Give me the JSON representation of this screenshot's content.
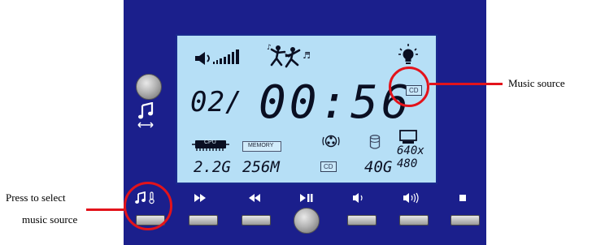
{
  "lcd": {
    "track": "02/",
    "time": "00:56",
    "cpu_label": "CPU",
    "cpu_value": "2.2G",
    "memory_label": "MEMORY",
    "memory_value": "256M",
    "cd_badge_top": "CD",
    "cd_badge_bottom": "CD",
    "disk_value": "40G",
    "resolution_top": "640x",
    "resolution_bottom": "480"
  },
  "annotations": {
    "music_source": "Music source",
    "press_line1": "Press to select",
    "press_line2": "music source"
  },
  "buttons": [
    {
      "name": "music-source",
      "icon": "music-note-thermometer-icon",
      "glyph": "♬🌡"
    },
    {
      "name": "fast-forward",
      "icon": "fast-forward-icon",
      "glyph": "▶▶"
    },
    {
      "name": "rewind",
      "icon": "rewind-icon",
      "glyph": "◀◀"
    },
    {
      "name": "play-pause",
      "icon": "play-pause-icon",
      "glyph": "▶II"
    },
    {
      "name": "volume-down",
      "icon": "volume-down-icon",
      "glyph": "🔈"
    },
    {
      "name": "volume-up",
      "icon": "volume-up-icon",
      "glyph": "🔊"
    },
    {
      "name": "stop",
      "icon": "stop-icon",
      "glyph": "■"
    }
  ],
  "colors": {
    "panel": "#1b1f8c",
    "lcd": "#b6dff6",
    "callout": "#e3131b"
  }
}
